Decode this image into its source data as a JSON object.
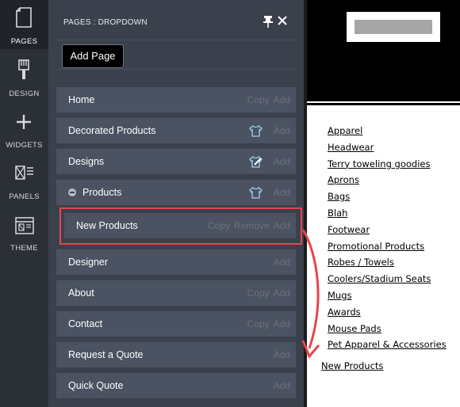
{
  "rail": {
    "items": [
      {
        "label": "PAGES",
        "icon": "page-icon",
        "active": true
      },
      {
        "label": "DESIGN",
        "icon": "brush-icon"
      },
      {
        "label": "WIDGETS",
        "icon": "plus-icon"
      },
      {
        "label": "PANELS",
        "icon": "panels-icon"
      },
      {
        "label": "THEME",
        "icon": "theme-icon"
      }
    ]
  },
  "panel": {
    "title": "PAGES : DROPDOWN",
    "add_page_label": "Add Page",
    "rows": [
      {
        "label": "Home",
        "actions": [
          "Copy",
          "Add"
        ]
      },
      {
        "label": "Decorated Products",
        "actions": [
          "Add"
        ],
        "icon": "shirt-icon"
      },
      {
        "label": "Designs",
        "actions": [
          "Add"
        ],
        "icon": "shirt-pencil-icon"
      },
      {
        "label": "Products",
        "actions": [
          "Add"
        ],
        "icon": "shirt-icon",
        "expanded": true
      },
      {
        "label": "New Products",
        "actions": [
          "Copy",
          "Remove",
          "Add"
        ],
        "child": true
      },
      {
        "label": "Designer",
        "actions": [
          "Add"
        ]
      },
      {
        "label": "About",
        "actions": [
          "Copy",
          "Add"
        ]
      },
      {
        "label": "Contact",
        "actions": [
          "Copy",
          "Add"
        ]
      },
      {
        "label": "Request a Quote",
        "actions": [
          "Add"
        ]
      },
      {
        "label": "Quick Quote",
        "actions": [
          "Add"
        ]
      }
    ]
  },
  "preview": {
    "menu": [
      "Apparel",
      "Headwear",
      "Terry toweling goodies",
      "Aprons",
      "Bags",
      "Blah",
      "Footwear",
      "Promotional Products",
      "Robes / Towels",
      "Coolers/Stadium Seats",
      "Mugs",
      "Awards",
      "Mouse Pads",
      "Pet Apparel & Accessories"
    ],
    "new_link": "New Products"
  },
  "colors": {
    "panel_bg": "#3b414c",
    "row_bg": "#4b5261",
    "highlight": "#e8444d"
  }
}
